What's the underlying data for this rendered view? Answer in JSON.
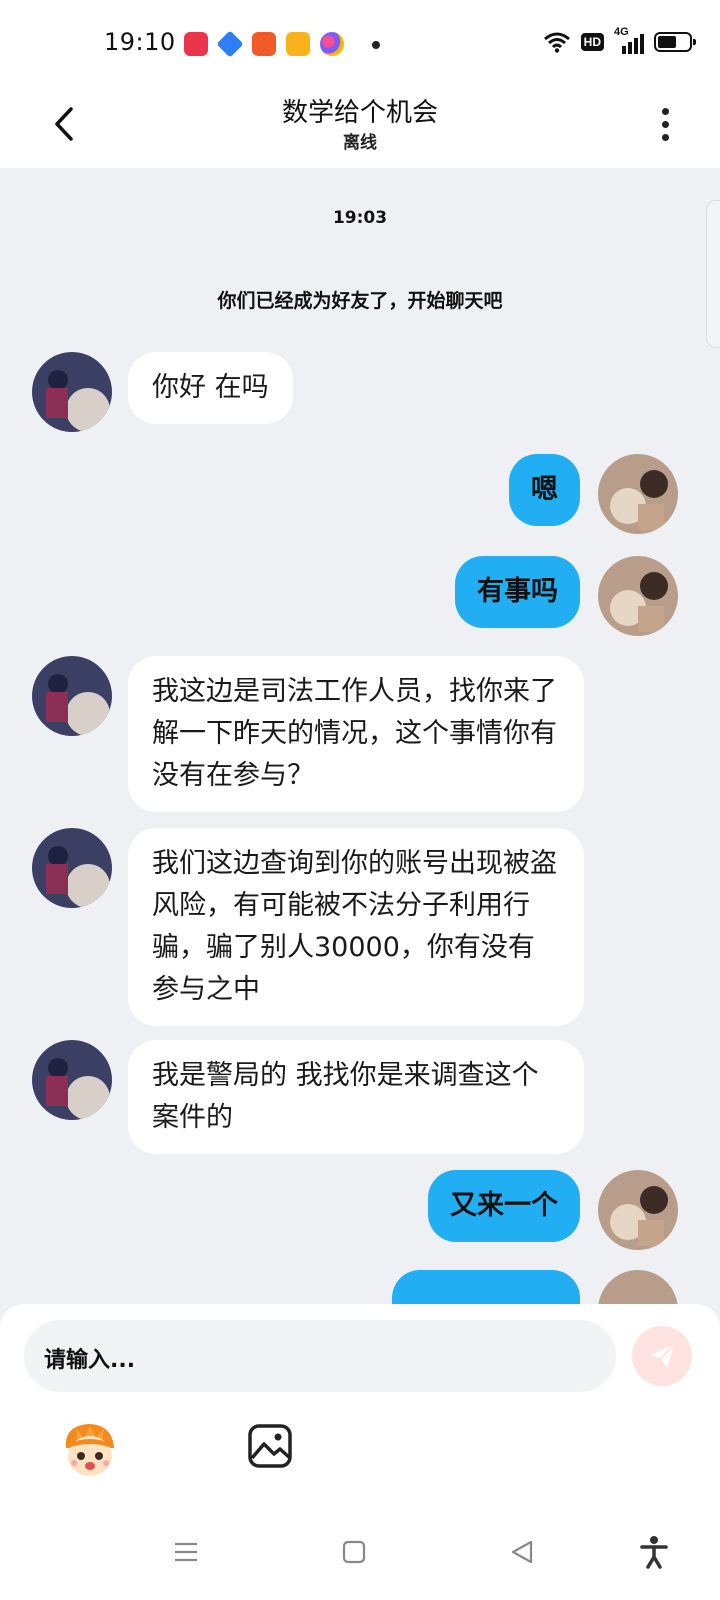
{
  "status_bar": {
    "time": "19:10",
    "hd_label": "HD",
    "network_label": "4G",
    "battery_level": 0.66
  },
  "header": {
    "title": "数学给个机会",
    "subtitle": "离线"
  },
  "chat": {
    "timestamp": "19:03",
    "system_message": "你们已经成为好友了，开始聊天吧",
    "messages": [
      {
        "side": "left",
        "text": "你好 在吗"
      },
      {
        "side": "right",
        "text": "嗯"
      },
      {
        "side": "right",
        "text": "有事吗"
      },
      {
        "side": "left",
        "text": "我这边是司法工作人员，找你来了解一下昨天的情况，这个事情你有没有在参与？"
      },
      {
        "side": "left",
        "text": "我们这边查询到你的账号出现被盗风险，有可能被不法分子利用行骗，骗了别人30000，你有没有参与之中"
      },
      {
        "side": "left",
        "text": "我是警局的 我找你是来调查这个案件的"
      },
      {
        "side": "right",
        "text": "又来一个"
      }
    ]
  },
  "input": {
    "placeholder": "请输入..."
  },
  "colors": {
    "bubble_self": "#22aef2",
    "bubble_other": "#ffffff",
    "background": "#eef0f4",
    "send_button": "#ffe3e1"
  },
  "icons": {
    "back": "chevron-left-icon",
    "more": "more-vertical-icon",
    "send": "send-icon",
    "emoji": "emoji-mascot-icon",
    "image": "image-icon",
    "nav_menu": "menu-icon",
    "nav_home": "home-square-icon",
    "nav_back": "triangle-back-icon",
    "accessibility": "accessibility-icon"
  }
}
